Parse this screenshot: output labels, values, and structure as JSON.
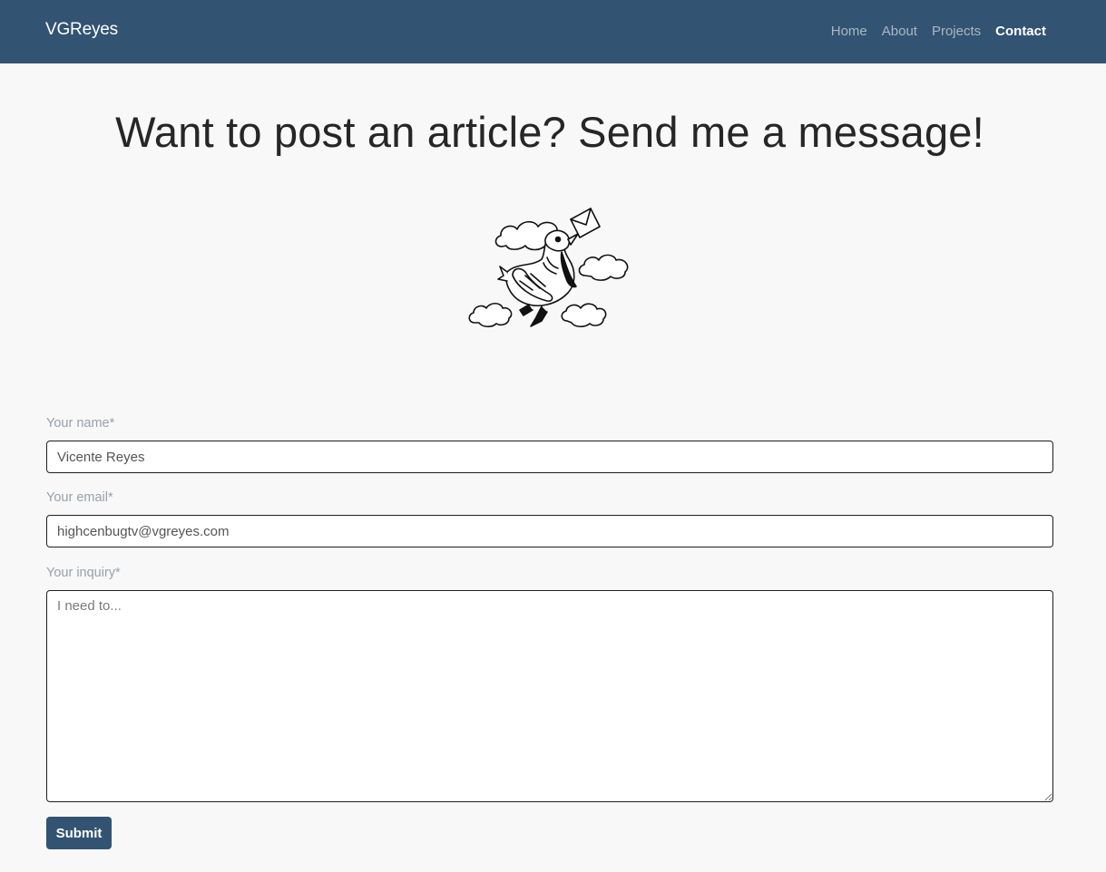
{
  "navbar": {
    "brand": "VGReyes",
    "links": [
      {
        "label": "Home",
        "active": false
      },
      {
        "label": "About",
        "active": false
      },
      {
        "label": "Projects",
        "active": false
      },
      {
        "label": "Contact",
        "active": true
      }
    ],
    "background_color": "#325372"
  },
  "page": {
    "title": "Want to post an article? Send me a message!",
    "illustration": "bird-carrying-letter-icon"
  },
  "form": {
    "name_label": "Your name*",
    "name_value": "Vicente Reyes",
    "email_label": "Your email*",
    "email_value": "highcenbugtv@vgreyes.com",
    "inquiry_label": "Your inquiry*",
    "inquiry_placeholder": "I need to...",
    "submit_label": "Submit"
  }
}
